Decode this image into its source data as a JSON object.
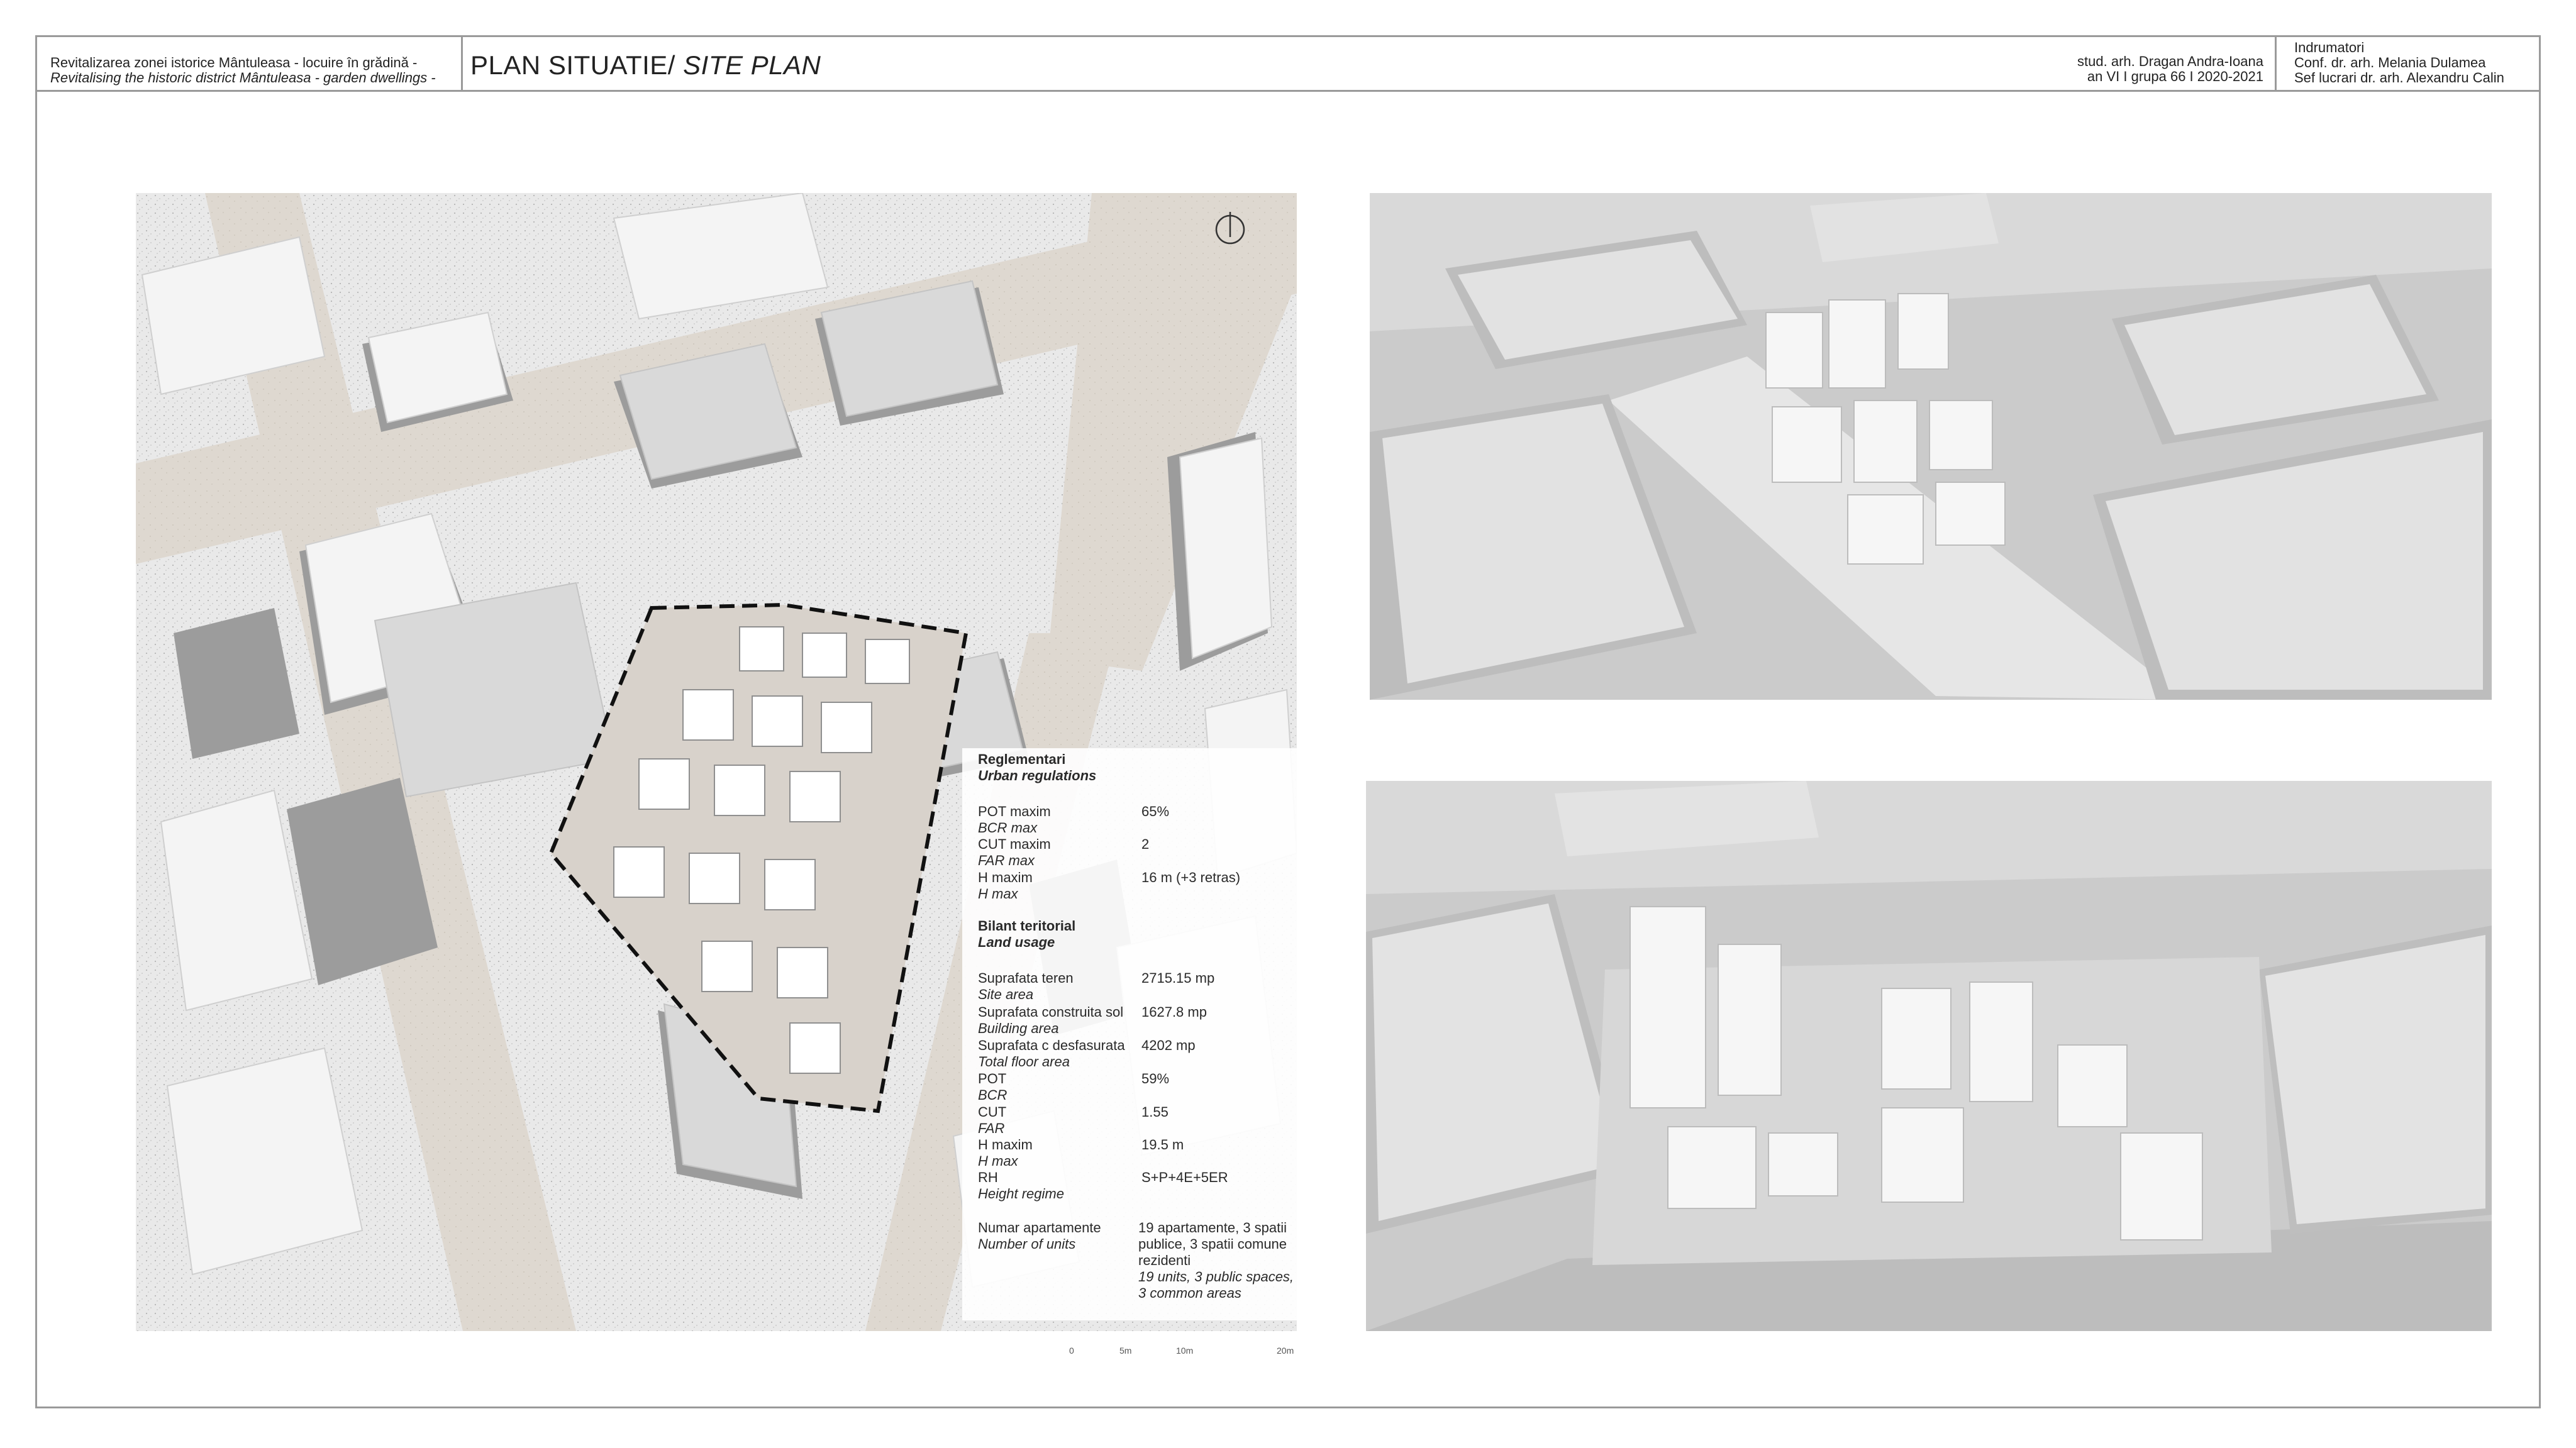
{
  "header": {
    "project_ro": "Revitalizarea zonei istorice Mântuleasa - locuire în grădină -",
    "project_en": "Revitalising the historic district Mântuleasa - garden dwellings -",
    "title_main": "PLAN SITUATIE/ ",
    "title_en": "SITE PLAN",
    "student_name": "stud. arh. Dragan Andra-Ioana",
    "student_info": "an VI  I  grupa 66  I  2020-2021",
    "tutors_label": "Indrumatori",
    "tutor1": "Conf. dr. arh. Melania Dulamea",
    "tutor2": "Sef lucrari dr. arh. Alexandru Calin"
  },
  "regulations": {
    "heading_ro": "Reglementari",
    "heading_en": "Urban regulations",
    "pot_label": "POT maxim",
    "pot_label_en": "BCR max",
    "pot_value": "65%",
    "cut_label": "CUT maxim",
    "cut_label_en": "FAR max",
    "cut_value": "2",
    "h_label": "H maxim",
    "h_label_en": "H max",
    "h_value": "16 m (+3 retras)"
  },
  "land_usage": {
    "heading_ro": "Bilant teritorial",
    "heading_en": "Land usage",
    "site_label": "Suprafata teren",
    "site_label_en": "Site area",
    "site_value": "2715.15 mp",
    "built_label": "Suprafata construita sol",
    "built_label_en": "Building area",
    "built_value": "1627.8 mp",
    "floor_label": "Suprafata c desfasurata",
    "floor_label_en": "Total floor area",
    "floor_value": "4202 mp",
    "pot_label": "POT",
    "pot_label_en": "BCR",
    "pot_value": "59%",
    "cut_label": "CUT",
    "cut_label_en": "FAR",
    "cut_value": "1.55",
    "h_label": "H maxim",
    "h_label_en": "H max",
    "h_value": "19.5 m",
    "rh_label": "RH",
    "rh_label_en": "Height regime",
    "rh_value": "S+P+4E+5ER",
    "units_label": "Numar apartamente",
    "units_label_en": "Number of units",
    "units_value_ro_1": "19 apartamente, 3 spatii",
    "units_value_ro_2": "publice, 3 spatii comune",
    "units_value_ro_3": "rezidenti",
    "units_value_en_1": "19 units, 3 public spaces,",
    "units_value_en_2": "3 common areas"
  },
  "scale_bar": {
    "t0": "0",
    "t1": "5m",
    "t2": "10m",
    "t3": "20m"
  }
}
